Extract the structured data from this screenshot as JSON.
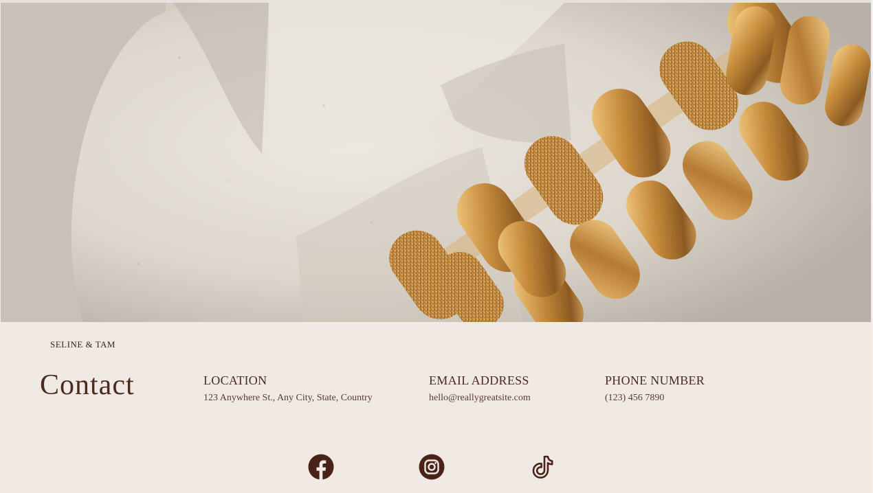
{
  "brand": "SELINE & TAM",
  "heading": "Contact",
  "contact": {
    "location": {
      "label": "LOCATION",
      "value": "123 Anywhere St., Any City, State, Country"
    },
    "email": {
      "label": "EMAIL ADDRESS",
      "value": "hello@reallygreatsite.com"
    },
    "phone": {
      "label": "PHONE NUMBER",
      "value": "(123) 456 7890"
    }
  },
  "social": [
    "facebook-icon",
    "instagram-icon",
    "tiktok-icon"
  ],
  "colors": {
    "background": "#f0e9e4",
    "accent": "#4a2c1f",
    "gold": "#c9923f",
    "stone": "#e0dbd3"
  }
}
